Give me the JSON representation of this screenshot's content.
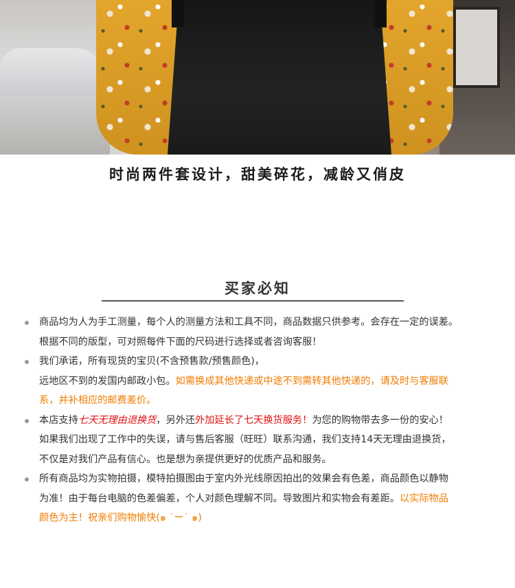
{
  "photo": {
    "alt": "",
    "colors": {
      "blouse": "#dba02a",
      "dress": "#1a1a1a",
      "background": "#d2d0cd"
    }
  },
  "tagline": "时尚两件套设计，甜美碎花，减龄又俏皮",
  "notice": {
    "title": "买家必知",
    "watermark": "",
    "accent_colors": {
      "orange": "#f07c00",
      "red": "#e01212"
    },
    "items": [
      {
        "line1": "商品均为人为手工测量，每个人的测量方法和工具不同，商品数据只供参考。会存在一定的误差。",
        "line2": "根据不同的版型，可对照每件下面的尺码进行选择或者咨询客服！"
      },
      {
        "line1": "我们承诺，所有现货的宝贝(不含预售款/预售颜色)，",
        "line2_plain": "远地区不到的发国内邮政小包。",
        "line2_orange": "如需换成其他快递或中途不到需转其他快递的，请及时与客服联",
        "line3_orange": "系，并补相应的邮费差价。"
      },
      {
        "line1_a": "本店支持",
        "line1_red_italic": "七天无理由退换货",
        "line1_b": "，另外还",
        "line1_red": "外加延长了七天换货服务！",
        "line1_c": "为您的购物带去多一份的安心！",
        "line2": "如果我们出现了工作中的失误，请与售后客服（旺旺）联系沟通，我们支持14天无理由退换货，",
        "line3": "不仅是对我们产品有信心。也是想为亲提供更好的优质产品和服务。"
      },
      {
        "line1": "所有商品均为实物拍摄，模特拍摄图由于室内外光线原因拍出的效果会有色差，商品颜色以静物",
        "line2_plain": "为准！由于每台电脑的色差偏差，个人对颜色理解不同。导致图片和实物会有差距。",
        "line2_orange": "以实际物品",
        "line3_orange": "颜色为主！祝亲们购物愉快(๑ ˙ー˙ ๑)"
      }
    ]
  }
}
